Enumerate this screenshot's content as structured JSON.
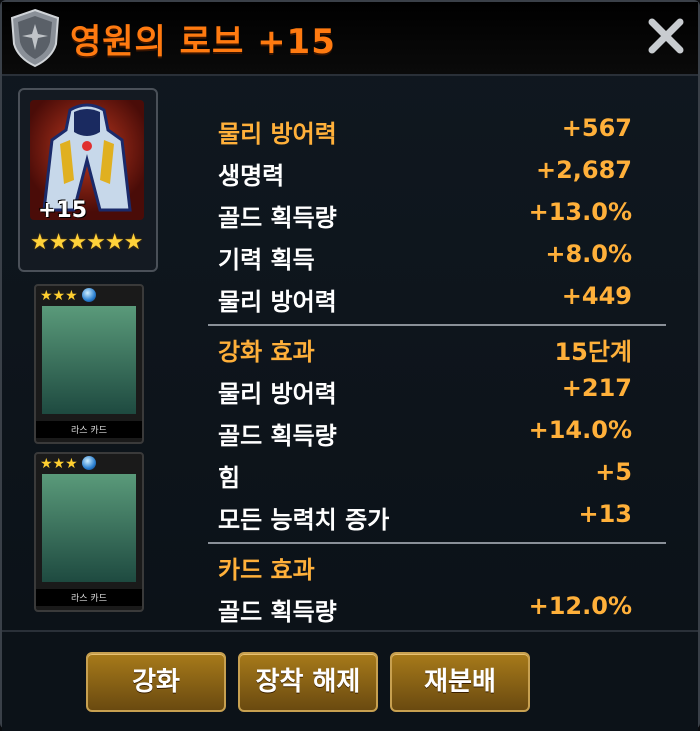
{
  "window": {
    "title": "영원의 로브 +15",
    "close_icon": "close-x"
  },
  "item": {
    "level_text": "+15",
    "stars": "★★★★★★"
  },
  "cards": [
    {
      "stars": "★★★",
      "label": "라스 카드"
    },
    {
      "stars": "★★★",
      "label": "라스 카드"
    }
  ],
  "stats": {
    "base": [
      {
        "label": "물리 방어력",
        "value": "+567",
        "head": true
      },
      {
        "label": "생명력",
        "value": "+2,687"
      },
      {
        "label": "골드 획득량",
        "value": "+13.0%"
      },
      {
        "label": "기력 획득",
        "value": "+8.0%"
      },
      {
        "label": "물리 방어력",
        "value": "+449"
      }
    ],
    "enhance": [
      {
        "label": "강화 효과",
        "value": "15단계",
        "head": true
      },
      {
        "label": "물리 방어력",
        "value": "+217"
      },
      {
        "label": "골드 획득량",
        "value": "+14.0%"
      },
      {
        "label": "힘",
        "value": "+5"
      },
      {
        "label": "모든 능력치 증가",
        "value": "+13"
      }
    ],
    "card_effect": [
      {
        "label": "카드 효과",
        "value": "",
        "head": true
      },
      {
        "label": "골드 획득량",
        "value": "+12.0%"
      }
    ]
  },
  "buttons": {
    "enhance": "강화",
    "unequip": "장착 해제",
    "redistribute": "재분배"
  },
  "colors": {
    "title": "#ff7a10",
    "accent": "#ffb03a",
    "button": "#8a6418"
  }
}
